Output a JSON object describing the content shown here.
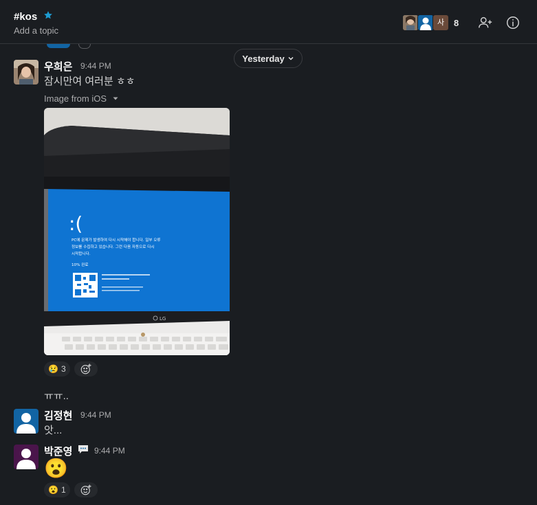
{
  "channel": {
    "name": "#kos",
    "topic_placeholder": "Add a topic",
    "member_count": "8",
    "avatar3_initial": "사"
  },
  "date_divider": {
    "label": "Yesterday"
  },
  "messages": [
    {
      "author": "우희은",
      "time": "9:44 PM",
      "text": "잠시만여 여러분 ㅎㅎ",
      "attachment_label": "Image from iOS",
      "attachment_screen_text": {
        "sad_face": ":(",
        "line1": "PC에 문제가 발생하여 다시 시작해야 합니다. 일부 오류",
        "line2": "정보를 수집하고 있습니다. 그런 다음 자동으로 다시",
        "line3": "시작합니다.",
        "progress": "10% 완료",
        "brand": "LG"
      },
      "reactions": [
        {
          "emoji": "😢",
          "count": "3"
        }
      ]
    },
    {
      "continuation_text": "ㅠㅠ.."
    },
    {
      "author": "김정현",
      "time": "9:44 PM",
      "text": "앗..."
    },
    {
      "author": "박준영",
      "time": "9:44 PM",
      "text": "😮",
      "reactions": [
        {
          "emoji": "😮",
          "count": "1"
        }
      ]
    }
  ],
  "colors": {
    "background": "#1a1d21",
    "accent": "#1264a3",
    "bsod_blue": "#0f74d2"
  },
  "icons": [
    "star-icon",
    "add-user-icon",
    "info-icon",
    "chevron-down-icon",
    "caret-down-icon",
    "add-reaction-icon",
    "speech-bubble-icon"
  ]
}
